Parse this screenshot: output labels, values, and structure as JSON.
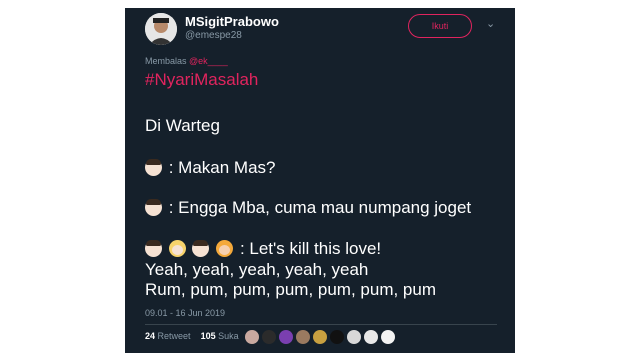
{
  "tweet": {
    "author_name": "MSigitPrabowo",
    "author_handle": "@emespe28",
    "follow_label": "Ikuti",
    "reply_label": "Membalas",
    "reply_to": "@ek____",
    "hashtag": "#NyariMasalah",
    "lines": [
      "Di Warteg",
      ": Makan Mas?",
      ": Engga Mba, cuma mau numpang joget",
      ": Let's kill this love!",
      "Yeah, yeah, yeah, yeah, yeah",
      "Rum, pum, pum, pum, pum, pum, pum"
    ],
    "timestamp": "09.01 - 16 Jun 2019",
    "retweet_count": "24",
    "retweet_label": "Retweet",
    "like_count": "105",
    "like_label": "Suka"
  },
  "colors": {
    "background": "#15202b",
    "accent": "#e0245e",
    "muted": "#8899a6"
  },
  "icons": [
    "avatar",
    "chevron-down-icon",
    "man-emoji",
    "blonde-woman-emoji",
    "woman-emoji"
  ]
}
